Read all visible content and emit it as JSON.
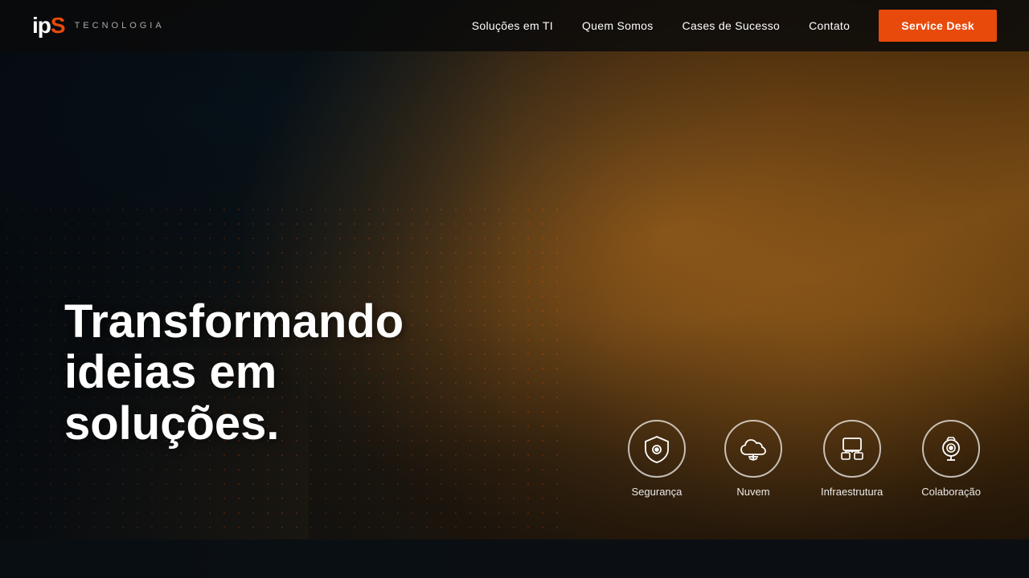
{
  "brand": {
    "logo_main": "ipS",
    "logo_sub": "TECNOLOGIA",
    "logo_orange_char": "S"
  },
  "nav": {
    "links": [
      {
        "label": "Soluções em TI",
        "id": "solucoes"
      },
      {
        "label": "Quem Somos",
        "id": "quem"
      },
      {
        "label": "Cases de Sucesso",
        "id": "cases"
      },
      {
        "label": "Contato",
        "id": "contato"
      }
    ],
    "cta_label": "Service Desk"
  },
  "hero": {
    "title_line1": "Transformando",
    "title_line2": "ideias em soluções."
  },
  "services": [
    {
      "id": "seguranca",
      "label": "Segurança",
      "icon": "security"
    },
    {
      "id": "nuvem",
      "label": "Nuvem",
      "icon": "cloud"
    },
    {
      "id": "infraestrutura",
      "label": "Infraestrutura",
      "icon": "infra"
    },
    {
      "id": "colaboracao",
      "label": "Colaboração",
      "icon": "collab"
    }
  ]
}
